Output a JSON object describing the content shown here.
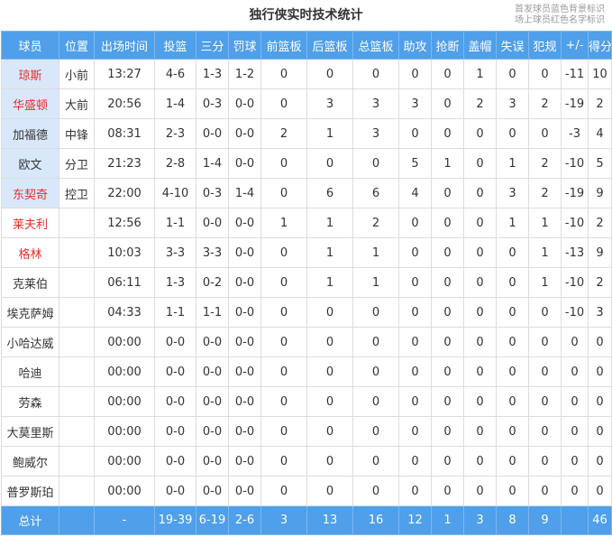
{
  "title": "独行侠实时技术统计",
  "legend": {
    "starter_note": "首发球员蓝色背景标识",
    "oncourt_note": "场上球员红色名字标识"
  },
  "columns": [
    "球员",
    "位置",
    "出场时间",
    "投篮",
    "三分",
    "罚球",
    "前篮板",
    "后篮板",
    "总篮板",
    "助攻",
    "抢断",
    "盖帽",
    "失误",
    "犯规",
    "+/-",
    "得分"
  ],
  "colors": {
    "header_bg": "#4f9fea",
    "starter_bg": "#d8e8fa",
    "oncourt_name": "#e6302b"
  },
  "players": [
    {
      "name": "琼斯",
      "pos": "小前",
      "min": "13:27",
      "fg": "4-6",
      "tp": "1-3",
      "ft": "1-2",
      "oreb": "0",
      "dreb": "0",
      "reb": "0",
      "ast": "0",
      "stl": "0",
      "blk": "1",
      "tov": "0",
      "pf": "0",
      "pm": "-11",
      "pts": "10",
      "starter": true,
      "oncourt": true
    },
    {
      "name": "华盛顿",
      "pos": "大前",
      "min": "20:56",
      "fg": "1-4",
      "tp": "0-3",
      "ft": "0-0",
      "oreb": "0",
      "dreb": "3",
      "reb": "3",
      "ast": "3",
      "stl": "0",
      "blk": "2",
      "tov": "3",
      "pf": "2",
      "pm": "-19",
      "pts": "2",
      "starter": true,
      "oncourt": true
    },
    {
      "name": "加福德",
      "pos": "中锋",
      "min": "08:31",
      "fg": "2-3",
      "tp": "0-0",
      "ft": "0-0",
      "oreb": "2",
      "dreb": "1",
      "reb": "3",
      "ast": "0",
      "stl": "0",
      "blk": "0",
      "tov": "0",
      "pf": "0",
      "pm": "-3",
      "pts": "4",
      "starter": true,
      "oncourt": false
    },
    {
      "name": "欧文",
      "pos": "分卫",
      "min": "21:23",
      "fg": "2-8",
      "tp": "1-4",
      "ft": "0-0",
      "oreb": "0",
      "dreb": "0",
      "reb": "0",
      "ast": "5",
      "stl": "1",
      "blk": "0",
      "tov": "1",
      "pf": "2",
      "pm": "-10",
      "pts": "5",
      "starter": true,
      "oncourt": false
    },
    {
      "name": "东契奇",
      "pos": "控卫",
      "min": "22:00",
      "fg": "4-10",
      "tp": "0-3",
      "ft": "1-4",
      "oreb": "0",
      "dreb": "6",
      "reb": "6",
      "ast": "4",
      "stl": "0",
      "blk": "0",
      "tov": "3",
      "pf": "2",
      "pm": "-19",
      "pts": "9",
      "starter": true,
      "oncourt": true
    },
    {
      "name": "莱夫利",
      "pos": "",
      "min": "12:56",
      "fg": "1-1",
      "tp": "0-0",
      "ft": "0-0",
      "oreb": "1",
      "dreb": "1",
      "reb": "2",
      "ast": "0",
      "stl": "0",
      "blk": "0",
      "tov": "1",
      "pf": "1",
      "pm": "-10",
      "pts": "2",
      "starter": false,
      "oncourt": true
    },
    {
      "name": "格林",
      "pos": "",
      "min": "10:03",
      "fg": "3-3",
      "tp": "3-3",
      "ft": "0-0",
      "oreb": "0",
      "dreb": "1",
      "reb": "1",
      "ast": "0",
      "stl": "0",
      "blk": "0",
      "tov": "0",
      "pf": "1",
      "pm": "-13",
      "pts": "9",
      "starter": false,
      "oncourt": true
    },
    {
      "name": "克莱伯",
      "pos": "",
      "min": "06:11",
      "fg": "1-3",
      "tp": "0-2",
      "ft": "0-0",
      "oreb": "0",
      "dreb": "1",
      "reb": "1",
      "ast": "0",
      "stl": "0",
      "blk": "0",
      "tov": "0",
      "pf": "1",
      "pm": "-10",
      "pts": "2",
      "starter": false,
      "oncourt": false
    },
    {
      "name": "埃克萨姆",
      "pos": "",
      "min": "04:33",
      "fg": "1-1",
      "tp": "1-1",
      "ft": "0-0",
      "oreb": "0",
      "dreb": "0",
      "reb": "0",
      "ast": "0",
      "stl": "0",
      "blk": "0",
      "tov": "0",
      "pf": "0",
      "pm": "-10",
      "pts": "3",
      "starter": false,
      "oncourt": false
    },
    {
      "name": "小哈达威",
      "pos": "",
      "min": "00:00",
      "fg": "0-0",
      "tp": "0-0",
      "ft": "0-0",
      "oreb": "0",
      "dreb": "0",
      "reb": "0",
      "ast": "0",
      "stl": "0",
      "blk": "0",
      "tov": "0",
      "pf": "0",
      "pm": "0",
      "pts": "0",
      "starter": false,
      "oncourt": false
    },
    {
      "name": "哈迪",
      "pos": "",
      "min": "00:00",
      "fg": "0-0",
      "tp": "0-0",
      "ft": "0-0",
      "oreb": "0",
      "dreb": "0",
      "reb": "0",
      "ast": "0",
      "stl": "0",
      "blk": "0",
      "tov": "0",
      "pf": "0",
      "pm": "0",
      "pts": "0",
      "starter": false,
      "oncourt": false
    },
    {
      "name": "劳森",
      "pos": "",
      "min": "00:00",
      "fg": "0-0",
      "tp": "0-0",
      "ft": "0-0",
      "oreb": "0",
      "dreb": "0",
      "reb": "0",
      "ast": "0",
      "stl": "0",
      "blk": "0",
      "tov": "0",
      "pf": "0",
      "pm": "0",
      "pts": "0",
      "starter": false,
      "oncourt": false
    },
    {
      "name": "大莫里斯",
      "pos": "",
      "min": "00:00",
      "fg": "0-0",
      "tp": "0-0",
      "ft": "0-0",
      "oreb": "0",
      "dreb": "0",
      "reb": "0",
      "ast": "0",
      "stl": "0",
      "blk": "0",
      "tov": "0",
      "pf": "0",
      "pm": "0",
      "pts": "0",
      "starter": false,
      "oncourt": false
    },
    {
      "name": "鲍威尔",
      "pos": "",
      "min": "00:00",
      "fg": "0-0",
      "tp": "0-0",
      "ft": "0-0",
      "oreb": "0",
      "dreb": "0",
      "reb": "0",
      "ast": "0",
      "stl": "0",
      "blk": "0",
      "tov": "0",
      "pf": "0",
      "pm": "0",
      "pts": "0",
      "starter": false,
      "oncourt": false
    },
    {
      "name": "普罗斯珀",
      "pos": "",
      "min": "00:00",
      "fg": "0-0",
      "tp": "0-0",
      "ft": "0-0",
      "oreb": "0",
      "dreb": "0",
      "reb": "0",
      "ast": "0",
      "stl": "0",
      "blk": "0",
      "tov": "0",
      "pf": "0",
      "pm": "0",
      "pts": "0",
      "starter": false,
      "oncourt": false
    }
  ],
  "totals": {
    "label": "总计",
    "pos": "",
    "min": "-",
    "fg": "19-39",
    "tp": "6-19",
    "ft": "2-6",
    "oreb": "3",
    "dreb": "13",
    "reb": "16",
    "ast": "12",
    "stl": "1",
    "blk": "3",
    "tov": "8",
    "pf": "9",
    "pm": "",
    "pts": "46"
  }
}
